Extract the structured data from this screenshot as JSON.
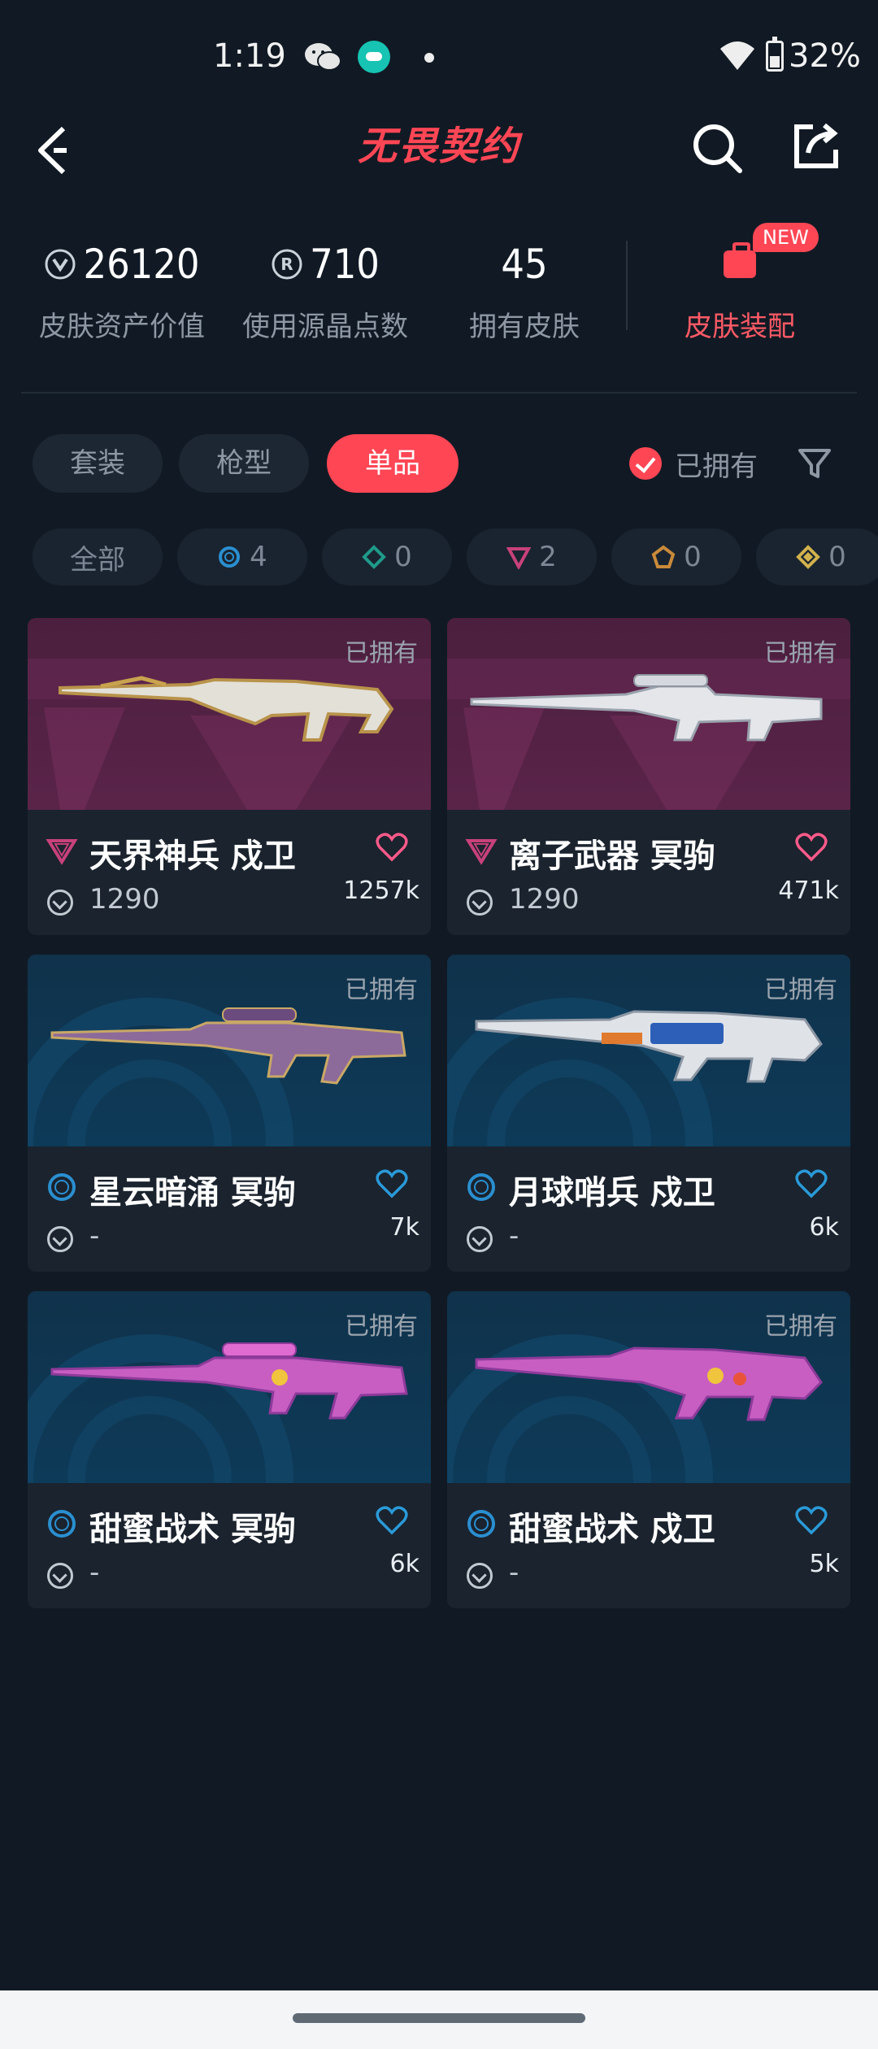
{
  "status_bar": {
    "time": "1:19",
    "battery": "32%"
  },
  "header": {
    "title": "无畏契约"
  },
  "stats": [
    {
      "value": "26120",
      "label": "皮肤资产价值",
      "icon": "valorant-point-icon"
    },
    {
      "value": "710",
      "label": "使用源晶点数",
      "icon": "radianite-icon"
    },
    {
      "value": "45",
      "label": "拥有皮肤",
      "icon": ""
    }
  ],
  "kit": {
    "label": "皮肤装配",
    "badge": "NEW"
  },
  "tabs": [
    {
      "label": "套装",
      "active": false
    },
    {
      "label": "枪型",
      "active": false
    },
    {
      "label": "单品",
      "active": true
    }
  ],
  "owned_filter": {
    "label": "已拥有",
    "checked": true
  },
  "tiers": [
    {
      "label": "全部"
    },
    {
      "count": "4",
      "icon": "select-tier-icon",
      "color": "#2a8fd0"
    },
    {
      "count": "0",
      "icon": "deluxe-tier-icon",
      "color": "#1f9a8a"
    },
    {
      "count": "2",
      "icon": "premium-tier-icon",
      "color": "#c8417a"
    },
    {
      "count": "0",
      "icon": "exclusive-tier-icon",
      "color": "#c98a3a"
    },
    {
      "count": "0",
      "icon": "ultra-tier-icon",
      "color": "#d2b24c"
    }
  ],
  "colors": {
    "accent": "#ff4655",
    "background": "#111a24",
    "card": "#1a232e"
  },
  "skins": [
    {
      "name": "天界神兵 戍卫",
      "price": "1290",
      "likes": "1257k",
      "owned": "已拥有",
      "tier": "premium"
    },
    {
      "name": "离子武器 冥驹",
      "price": "1290",
      "likes": "471k",
      "owned": "已拥有",
      "tier": "premium"
    },
    {
      "name": "星云暗涌 冥驹",
      "price": "-",
      "likes": "7k",
      "owned": "已拥有",
      "tier": "select"
    },
    {
      "name": "月球哨兵 戍卫",
      "price": "-",
      "likes": "6k",
      "owned": "已拥有",
      "tier": "select"
    },
    {
      "name": "甜蜜战术 冥驹",
      "price": "-",
      "likes": "6k",
      "owned": "已拥有",
      "tier": "select"
    },
    {
      "name": "甜蜜战术 戍卫",
      "price": "-",
      "likes": "5k",
      "owned": "已拥有",
      "tier": "select"
    }
  ]
}
